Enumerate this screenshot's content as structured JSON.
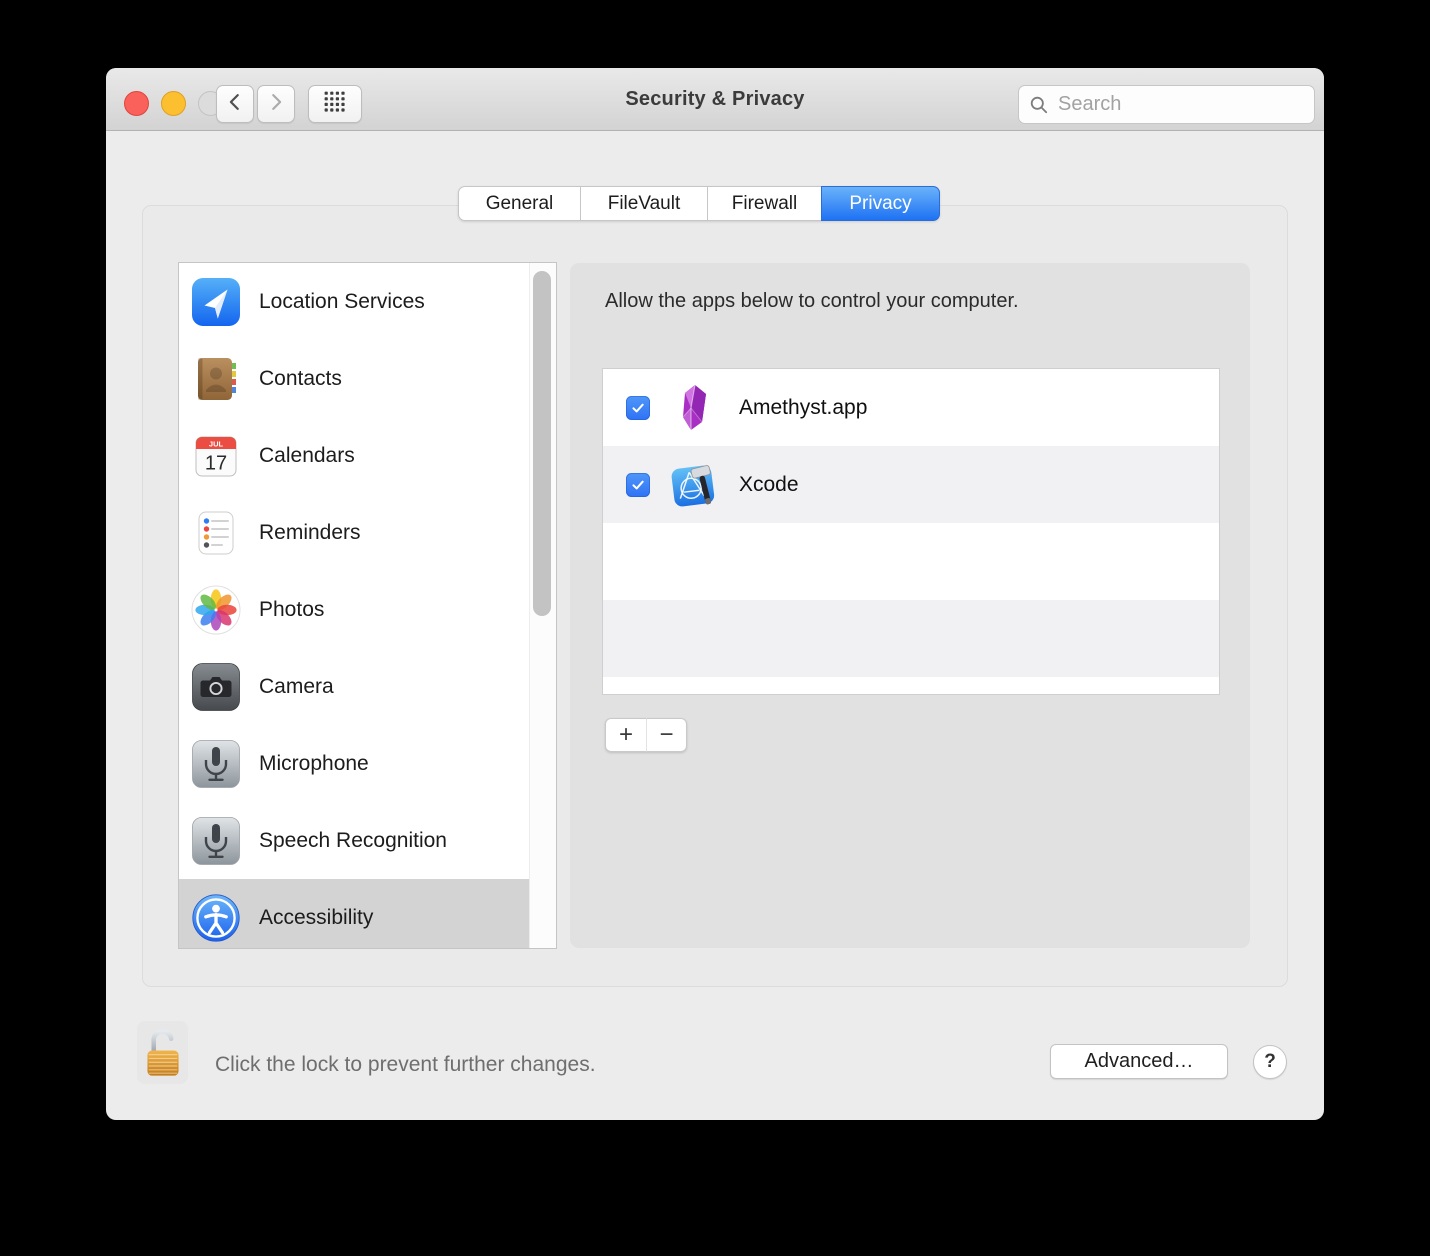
{
  "window": {
    "title": "Security & Privacy"
  },
  "toolbar": {
    "search_placeholder": "Search",
    "back_icon": "chevron-left-icon",
    "forward_icon": "chevron-right-icon",
    "show_all_icon": "grid-icon",
    "search_icon": "search-icon"
  },
  "tabs": {
    "items": [
      {
        "label": "General",
        "active": false
      },
      {
        "label": "FileVault",
        "active": false
      },
      {
        "label": "Firewall",
        "active": false
      },
      {
        "label": "Privacy",
        "active": true
      }
    ]
  },
  "sidebar": {
    "selected": "Accessibility",
    "items": [
      {
        "label": "Location Services",
        "icon": "location-icon",
        "selected": false
      },
      {
        "label": "Contacts",
        "icon": "contacts-icon",
        "selected": false
      },
      {
        "label": "Calendars",
        "icon": "calendar-icon",
        "selected": false
      },
      {
        "label": "Reminders",
        "icon": "reminders-icon",
        "selected": false
      },
      {
        "label": "Photos",
        "icon": "photos-icon",
        "selected": false
      },
      {
        "label": "Camera",
        "icon": "camera-icon",
        "selected": false
      },
      {
        "label": "Microphone",
        "icon": "microphone-icon",
        "selected": false
      },
      {
        "label": "Speech Recognition",
        "icon": "microphone-icon",
        "selected": false
      },
      {
        "label": "Accessibility",
        "icon": "accessibility-icon",
        "selected": true
      }
    ]
  },
  "content": {
    "header": "Allow the apps below to control your computer.",
    "apps": [
      {
        "name": "Amethyst.app",
        "icon": "amethyst-icon",
        "checked": true
      },
      {
        "name": "Xcode",
        "icon": "xcode-icon",
        "checked": true
      }
    ],
    "add_button": "+",
    "remove_button": "−"
  },
  "footer": {
    "lock_icon": "lock-open-icon",
    "lock_text": "Click the lock to prevent further changes.",
    "advanced_button": "Advanced…",
    "help_button": "?"
  },
  "colors": {
    "accent_blue": "#2d7ef7",
    "tab_active_top": "#6ab2fa",
    "tab_active_bottom": "#1e72f3",
    "checkbox_blue": "#3f87f8",
    "selected_row_gray": "#d3d3d3",
    "panel_gray": "#e1e1e1",
    "stripe_gray": "#f1f1f4",
    "traffic_red": "#f9615a",
    "traffic_yellow": "#fbbf2f",
    "traffic_gray": "#dcdcdc"
  }
}
